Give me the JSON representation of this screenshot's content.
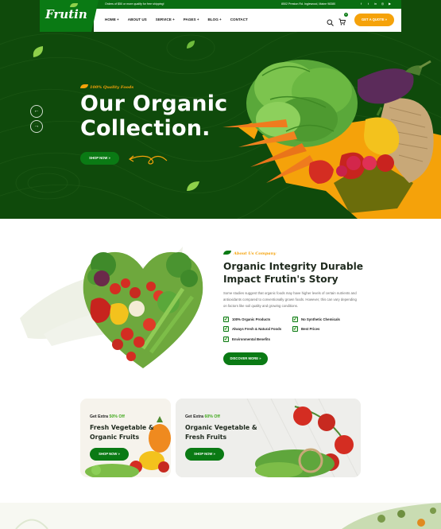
{
  "topbar": {
    "promo": "Orders of $50 or more qualify for free shipping!",
    "address": "8502 Preston Rd. Inglewood, Maine 98380",
    "social_icons": [
      "facebook-icon",
      "twitter-icon",
      "linkedin-icon",
      "instagram-icon",
      "youtube-icon"
    ]
  },
  "brand": {
    "logo": "Frutin"
  },
  "nav": {
    "items": [
      "HOME +",
      "ABOUT US",
      "SERVICE +",
      "PAGES +",
      "BLOG +",
      "CONTACT"
    ],
    "cart_count": "0",
    "quote_button": "GET A QUOTE  »"
  },
  "hero": {
    "tagline": "100% Quality Foods",
    "title_line1": "Our Organic",
    "title_line2": "Collection.",
    "button": "SHOP NOW  »",
    "prev": "←",
    "next": "→"
  },
  "about": {
    "tagline": "About Us Company",
    "title_line1": "Organic Integrity Durable",
    "title_line2": "Impact Frutin's Story",
    "description": "Some studies suggest that organic foods may have higher levels of certain nutrients and antioxidants compared to conventionally grown foods. However, this can vary depending on factors like soil quality and growing conditions.",
    "features": [
      "100% Organic Products",
      "No Synthetic Chemicals",
      "Always Fresh & Natural Foods",
      "Best Prices",
      "Environmental Benefits"
    ],
    "button": "DISCOVER MORE  »"
  },
  "promos": [
    {
      "extra_prefix": "Get Extra ",
      "extra_pct": "50% Off",
      "title_line1": "Fresh Vegetable &",
      "title_line2": "Organic Fruits",
      "button": "SHOP NOW  »"
    },
    {
      "extra_prefix": "Get Extra ",
      "extra_pct": "60% Off",
      "title_line1": "Organic Vegetable &",
      "title_line2": "Fresh Fruits",
      "button": "SHOP NOW  »"
    }
  ],
  "colors": {
    "primary_green": "#0a7a14",
    "hero_bg": "#0f4a0b",
    "accent_orange": "#f5a20a"
  }
}
